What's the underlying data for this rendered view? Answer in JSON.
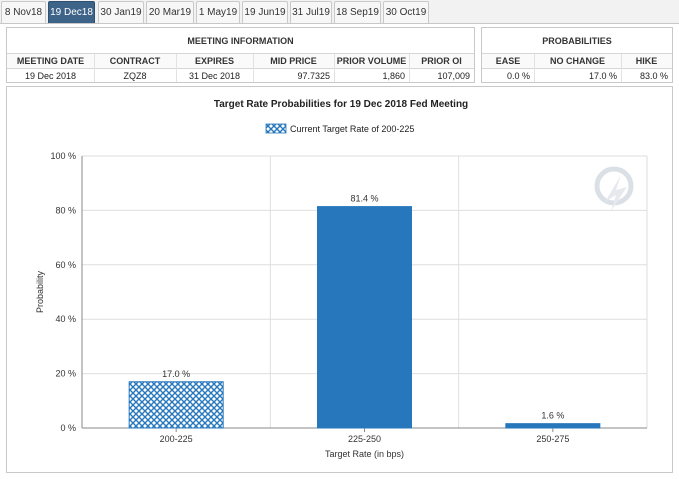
{
  "tabs": [
    {
      "label": "8 Nov18",
      "active": false
    },
    {
      "label": "19 Dec18",
      "active": true
    },
    {
      "label": "30 Jan19",
      "active": false
    },
    {
      "label": "20 Mar19",
      "active": false
    },
    {
      "label": "1 May19",
      "active": false
    },
    {
      "label": "19 Jun19",
      "active": false
    },
    {
      "label": "31 Jul19",
      "active": false
    },
    {
      "label": "18 Sep19",
      "active": false
    },
    {
      "label": "30 Oct19",
      "active": false
    }
  ],
  "meeting_info": {
    "title": "MEETING INFORMATION",
    "headers": [
      "MEETING DATE",
      "CONTRACT",
      "EXPIRES",
      "MID PRICE",
      "PRIOR VOLUME",
      "PRIOR OI"
    ],
    "values": [
      "19 Dec 2018",
      "ZQZ8",
      "31 Dec 2018",
      "97.7325",
      "1,860",
      "107,009"
    ]
  },
  "probabilities": {
    "title": "PROBABILITIES",
    "headers": [
      "EASE",
      "NO CHANGE",
      "HIKE"
    ],
    "values": [
      "0.0 %",
      "17.0 %",
      "83.0 %"
    ]
  },
  "chart_data": {
    "type": "bar",
    "title": "Target Rate Probabilities for 19 Dec 2018 Fed Meeting",
    "legend": {
      "label": "Current Target Rate of 200-225",
      "placement": "top-center"
    },
    "categories": [
      "200-225",
      "225-250",
      "250-275"
    ],
    "values": [
      17.0,
      81.4,
      1.6
    ],
    "data_labels": [
      "17.0 %",
      "81.4 %",
      "1.6 %"
    ],
    "current_category": "200-225",
    "xlabel": "Target Rate (in bps)",
    "ylabel": "Probability",
    "ylim": [
      0,
      100
    ],
    "yticks": [
      0,
      20,
      40,
      60,
      80,
      100
    ],
    "ytick_labels": [
      "0 %",
      "20 %",
      "40 %",
      "60 %",
      "80 %",
      "100 %"
    ],
    "grid": true,
    "colors": {
      "bar": "#2677bc",
      "current_pattern": "#2677bc"
    }
  }
}
